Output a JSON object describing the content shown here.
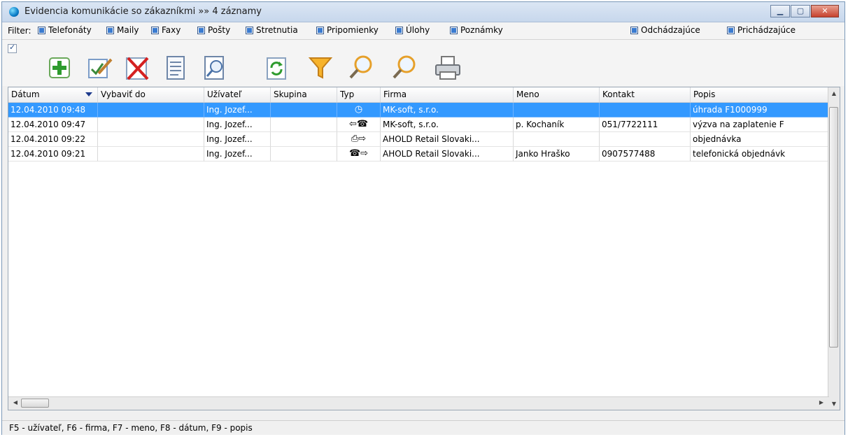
{
  "window": {
    "title": "Evidencia komunikácie so zákazníkmi »» 4 záznamy"
  },
  "filter": {
    "label": "Filter:",
    "items": [
      "Telefonáty",
      "Maily",
      "Faxy",
      "Pošty",
      "Stretnutia",
      "Pripomienky",
      "Úlohy",
      "Poznámky"
    ],
    "direction": [
      "Odchádzajúce",
      "Prichádzajúce"
    ]
  },
  "toolbar": {
    "icons": [
      "add-icon",
      "edit-icon",
      "delete-icon",
      "copy-icon",
      "preview-icon",
      "refresh-icon",
      "filter-icon",
      "search-icon",
      "search-next-icon",
      "print-icon"
    ]
  },
  "grid": {
    "columns": [
      "Dátum",
      "Vybaviť do",
      "Užívateľ",
      "Skupina",
      "Typ",
      "Firma",
      "Meno",
      "Kontakt",
      "Popis"
    ],
    "sorted_column": "Dátum",
    "rows": [
      {
        "datum": "12.04.2010 09:48",
        "vybavit": "",
        "uzivatel": "Ing. Jozef...",
        "skupina": "",
        "typ": "clock-icon",
        "firma": "MK-soft, s.r.o.",
        "meno": "",
        "kontakt": "",
        "popis": "úhrada F1000999",
        "selected": true
      },
      {
        "datum": "12.04.2010 09:47",
        "vybavit": "",
        "uzivatel": "Ing. Jozef...",
        "skupina": "",
        "typ": "incoming-phone-icon",
        "firma": "MK-soft, s.r.o.",
        "meno": "p. Kochaník",
        "kontakt": "051/7722111",
        "popis": "výzva na zaplatenie F",
        "selected": false
      },
      {
        "datum": "12.04.2010 09:22",
        "vybavit": "",
        "uzivatel": "Ing. Jozef...",
        "skupina": "",
        "typ": "outgoing-fax-icon",
        "firma": "AHOLD Retail Slovaki...",
        "meno": "",
        "kontakt": "",
        "popis": "objednávka",
        "selected": false
      },
      {
        "datum": "12.04.2010 09:21",
        "vybavit": "",
        "uzivatel": "Ing. Jozef...",
        "skupina": "",
        "typ": "outgoing-phone-icon",
        "firma": "AHOLD Retail Slovaki...",
        "meno": "Janko Hraško",
        "kontakt": "0907577488",
        "popis": "telefonická objednávk",
        "selected": false
      }
    ]
  },
  "status": {
    "text": "F5 - užívateľ, F6 - firma, F7 - meno, F8 - dátum, F9 - popis"
  },
  "colors": {
    "selection": "#3399ff",
    "titlebar": "#c7d7ec"
  }
}
